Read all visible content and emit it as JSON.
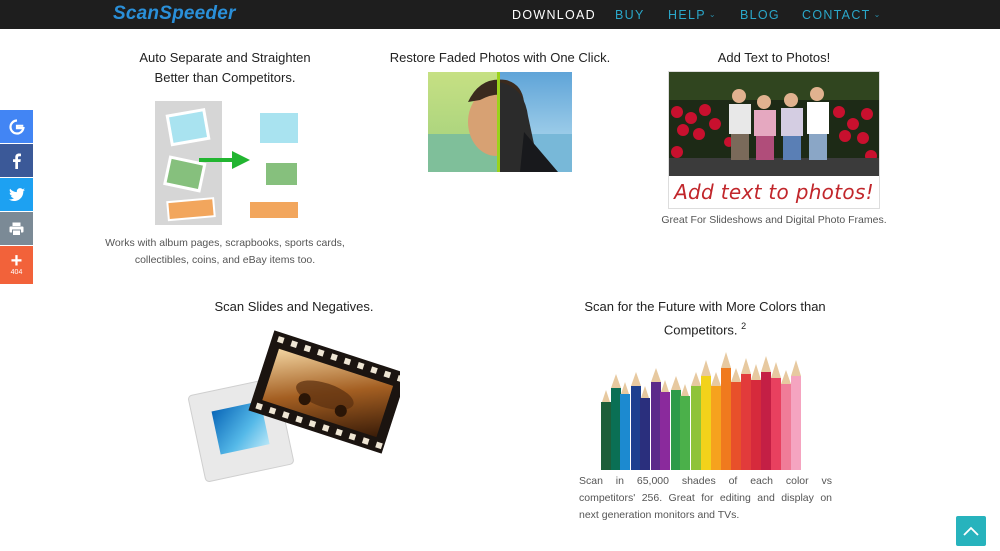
{
  "brand": {
    "logo_text": "ScanSpeeder"
  },
  "nav": {
    "download": "DOWNLOAD",
    "buy": "BUY",
    "help": "HELP",
    "blog": "BLOG",
    "contact": "CONTACT"
  },
  "share": {
    "items": [
      {
        "icon": "google-icon",
        "color": "#4285f4"
      },
      {
        "icon": "facebook-icon",
        "color": "#3b5998"
      },
      {
        "icon": "twitter-icon",
        "color": "#1da1f2"
      },
      {
        "icon": "print-icon",
        "color": "#7b8a96"
      },
      {
        "icon": "plus-icon",
        "color": "#f2623a"
      }
    ],
    "count": "404"
  },
  "features": {
    "separate": {
      "title_line1": "Auto Separate and Straighten",
      "title_line2": "Better than Competitors.",
      "caption_line1": "Works with album pages, scrapbooks, sports cards,",
      "caption_line2": "collectibles, coins, and eBay items too."
    },
    "restore": {
      "title": "Restore Faded Photos with One Click."
    },
    "addtext": {
      "title": "Add Text to Photos!",
      "image_text": "Add text to photos!",
      "caption": "Great For Slideshows and Digital Photo Frames."
    },
    "slides": {
      "title": "Scan Slides and Negatives."
    },
    "colors": {
      "title_line1": "Scan for the Future with More Colors than",
      "title_line2": "Competitors.",
      "footnote": "2",
      "caption_line1": "Scan in 65,000 shades of each color vs",
      "caption_line2": "competitors' 256. Great for editing and display on",
      "caption_line3": "next generation monitors and TVs."
    }
  },
  "colors": {
    "nav_bg": "#1e1e1e",
    "accent": "#2aa7c9",
    "logo": "#2a8fd8",
    "totop": "#27b3bd"
  }
}
